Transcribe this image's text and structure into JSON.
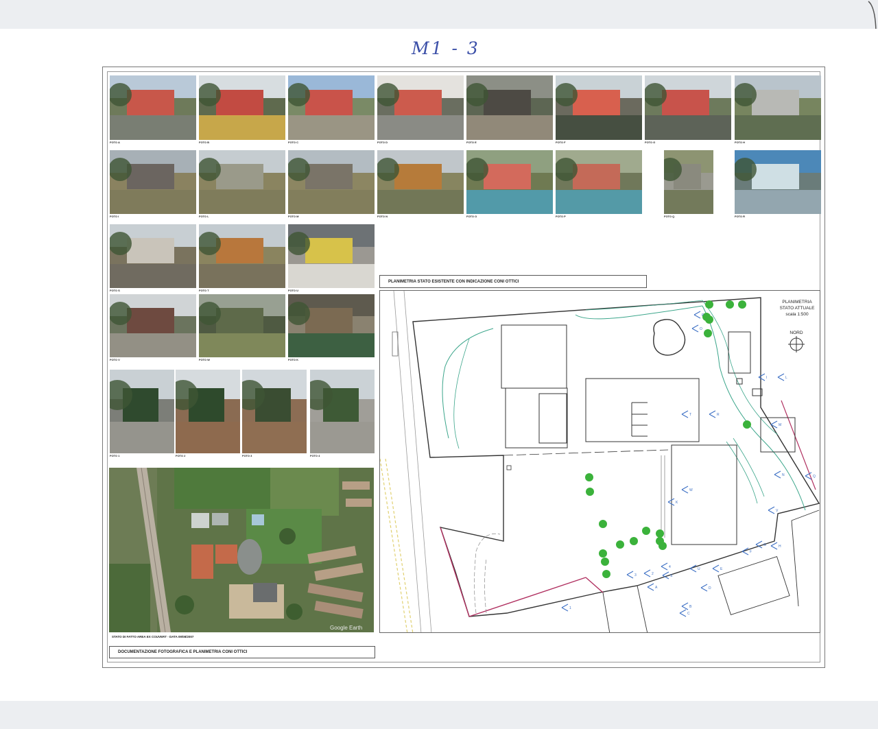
{
  "handwritten_note": "M1 - 3",
  "photos": [
    {
      "label": "FOTO A"
    },
    {
      "label": "FOTO B"
    },
    {
      "label": "FOTO C"
    },
    {
      "label": "FOTO D"
    },
    {
      "label": "FOTO E"
    },
    {
      "label": "FOTO F"
    },
    {
      "label": "FOTO G"
    },
    {
      "label": "FOTO H"
    },
    {
      "label": "FOTO I"
    },
    {
      "label": "FOTO L"
    },
    {
      "label": "FOTO M"
    },
    {
      "label": "FOTO N"
    },
    {
      "label": "FOTO O"
    },
    {
      "label": "FOTO P"
    },
    {
      "label": "FOTO Q"
    },
    {
      "label": "FOTO R"
    },
    {
      "label": "FOTO S"
    },
    {
      "label": "FOTO T"
    },
    {
      "label": "FOTO U"
    },
    {
      "label": "FOTO V"
    },
    {
      "label": "FOTO W"
    },
    {
      "label": "FOTO K"
    },
    {
      "label": "FOTO 1"
    },
    {
      "label": "FOTO 2"
    },
    {
      "label": "FOTO 3"
    },
    {
      "label": "FOTO 4"
    }
  ],
  "aerial": {
    "caption": "STATO DI FATTO AREA EX COUVERT - DATA 09/08/2007",
    "watermark": "Google Earth"
  },
  "plan_header": "PLANIMETRIA STATO ESISTENTE CON INDICAZIONE CONI OTTICI",
  "plan": {
    "title_line1": "PLANIMETRIA",
    "title_line2": "STATO ATTUALE",
    "scale": "scala 1:500",
    "north": "NORD",
    "markers": [
      {
        "letter": "A"
      },
      {
        "letter": "B"
      },
      {
        "letter": "C"
      },
      {
        "letter": "D"
      },
      {
        "letter": "E"
      },
      {
        "letter": "F"
      },
      {
        "letter": "G"
      },
      {
        "letter": "H"
      },
      {
        "letter": "I"
      },
      {
        "letter": "L"
      },
      {
        "letter": "M"
      },
      {
        "letter": "N"
      },
      {
        "letter": "O"
      },
      {
        "letter": "P"
      },
      {
        "letter": "Q"
      },
      {
        "letter": "R"
      },
      {
        "letter": "S"
      },
      {
        "letter": "T"
      },
      {
        "letter": "U"
      },
      {
        "letter": "V"
      },
      {
        "letter": "W"
      },
      {
        "letter": "K"
      },
      {
        "letter": "1"
      },
      {
        "letter": "2"
      },
      {
        "letter": "3"
      },
      {
        "letter": "4"
      }
    ]
  },
  "footer_label": "DOCUMENTAZIONE FOTOGRAFICA E PLANIMETRIA CONI OTTICI"
}
